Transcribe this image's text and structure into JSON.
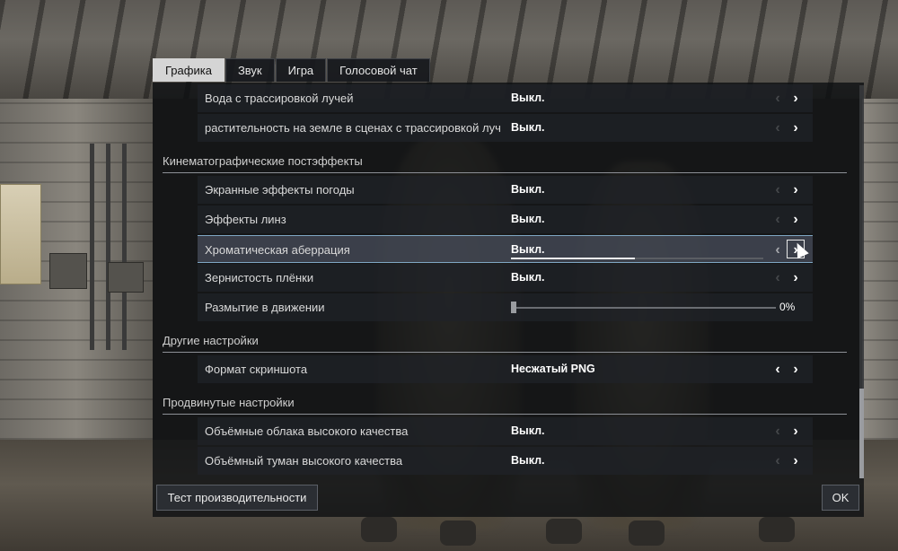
{
  "tabs": [
    "Графика",
    "Звук",
    "Игра",
    "Голосовой чат"
  ],
  "active_tab": "Графика",
  "rows_top": [
    {
      "label": "Вода с трассировкой лучей",
      "value": "Выкл.",
      "left_arrow_enabled": false,
      "right_arrow_enabled": true
    },
    {
      "label": "растительность на земле в сценах с трассировкой луч",
      "value": "Выкл.",
      "left_arrow_enabled": false,
      "right_arrow_enabled": true
    }
  ],
  "sections": {
    "cinematic": "Кинематографические постэффекты",
    "other": "Другие настройки",
    "advanced": "Продвинутые настройки"
  },
  "cinematic_rows": [
    {
      "label": "Экранные эффекты погоды",
      "value": "Выкл.",
      "left_arrow_enabled": false,
      "right_arrow_enabled": true
    },
    {
      "label": "Эффекты линз",
      "value": "Выкл.",
      "left_arrow_enabled": false,
      "right_arrow_enabled": true
    },
    {
      "label": "Хроматическая аберрация",
      "value": "Выкл.",
      "left_arrow_enabled": false,
      "right_arrow_enabled": true,
      "selected": true,
      "progress_fraction": 0.49
    },
    {
      "label": "Зернистость плёнки",
      "value": "Выкл.",
      "left_arrow_enabled": false,
      "right_arrow_enabled": true
    }
  ],
  "motion_blur": {
    "label": "Размытие в движении",
    "value_text": "0%",
    "value": 0
  },
  "other_rows": [
    {
      "label": "Формат скриншота",
      "value": "Несжатый PNG",
      "left_arrow_enabled": true,
      "right_arrow_enabled": true
    }
  ],
  "advanced_rows": [
    {
      "label": "Объёмные облака высокого качества",
      "value": "Выкл.",
      "left_arrow_enabled": false,
      "right_arrow_enabled": true
    },
    {
      "label": "Объёмный туман высокого качества",
      "value": "Выкл.",
      "left_arrow_enabled": false,
      "right_arrow_enabled": true
    }
  ],
  "icons": {
    "left": "chevron-left-icon",
    "right": "chevron-right-icon"
  },
  "glyphs": {
    "left": "‹",
    "right": "›"
  },
  "buttons": {
    "benchmark": "Тест производительности",
    "ok": "OK"
  },
  "colors": {
    "accent_border": "#7fa7c4",
    "active_tab_bg": "#d5d5d5",
    "panel_bg": "#0c0e11"
  }
}
